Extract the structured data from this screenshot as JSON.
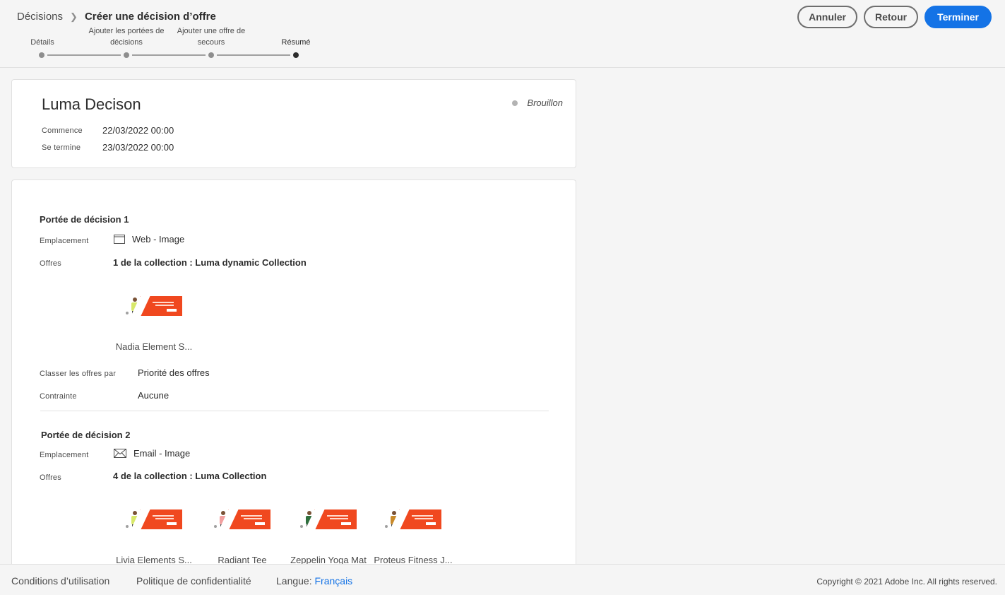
{
  "header": {
    "breadcrumb_root": "Décisions",
    "breadcrumb_current": "Créer une décision d’offre",
    "buttons": {
      "cancel": "Annuler",
      "back": "Retour",
      "finish": "Terminer"
    },
    "steps": [
      {
        "label": "Détails"
      },
      {
        "label": "Ajouter les portées de décisions"
      },
      {
        "label": "Ajouter une offre de secours"
      },
      {
        "label": "Résumé"
      }
    ]
  },
  "summary": {
    "title": "Luma Decison",
    "status": "Brouillon",
    "starts_label": "Commence",
    "starts_value": "22/03/2022 00:00",
    "ends_label": "Se termine",
    "ends_value": "23/03/2022 00:00"
  },
  "scopes": [
    {
      "title": "Portée de décision 1",
      "placement_label": "Emplacement",
      "placement_value": "Web - Image",
      "placement_icon": "web-image-icon",
      "offers_label": "Offres",
      "offers_heading": "1 de la collection : Luma dynamic Collection",
      "offers": [
        {
          "name": "Nadia Element S...",
          "shirt_color": "#d8e86a"
        }
      ],
      "rank_label": "Classer les offres par",
      "rank_value": "Priorité des offres",
      "constraint_label": "Contrainte",
      "constraint_value": "Aucune"
    },
    {
      "title": "Portée de décision 2",
      "placement_label": "Emplacement",
      "placement_value": "Email - Image",
      "placement_icon": "email-icon",
      "offers_label": "Offres",
      "offers_heading": "4 de la collection : Luma Collection",
      "offers": [
        {
          "name": "Livia Elements S...",
          "shirt_color": "#d8e86a"
        },
        {
          "name": "Radiant Tee",
          "shirt_color": "#f2a0a0"
        },
        {
          "name": "Zeppelin Yoga Mat",
          "shirt_color": "#2f6f3e"
        },
        {
          "name": "Proteus Fitness J...",
          "shirt_color": "#c98a2a"
        }
      ]
    }
  ],
  "footer": {
    "terms": "Conditions d’utilisation",
    "privacy": "Politique de confidentialité",
    "language_label": "Langue:",
    "language_value": "Français",
    "copyright": "Copyright ©  2021 Adobe Inc.  All rights reserved."
  },
  "colors": {
    "accent": "#1473e6",
    "banner": "#f0481f",
    "status_dot": "#b3b3b3"
  }
}
